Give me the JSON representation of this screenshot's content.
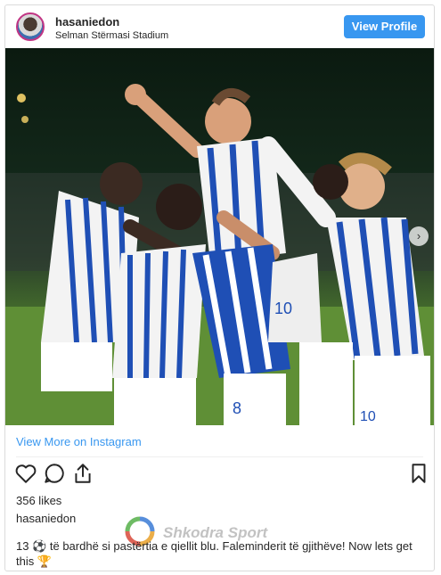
{
  "post": {
    "username": "hasaniedon",
    "location": "Selman Stërmasi Stadium",
    "view_profile_label": "View Profile",
    "view_more_label": "View More on Instagram",
    "likes": "356 likes",
    "owner": "hasaniedon",
    "caption": "13 ⚽ të bardhë si pastërtia e qiellit blu. Faleminderit të gjithëve! Now lets get this 🏆"
  },
  "watermark": {
    "text": "Shkodra Sport"
  },
  "photo": {
    "jersey_numbers": [
      "10",
      "8",
      "10"
    ]
  },
  "icons": [
    "heart-icon",
    "comment-icon",
    "share-icon",
    "bookmark-icon",
    "next-arrow-icon"
  ],
  "colors": {
    "accent": "#3897f0",
    "jersey_blue": "#1f4fb5",
    "pitch": "#5b8c33"
  }
}
